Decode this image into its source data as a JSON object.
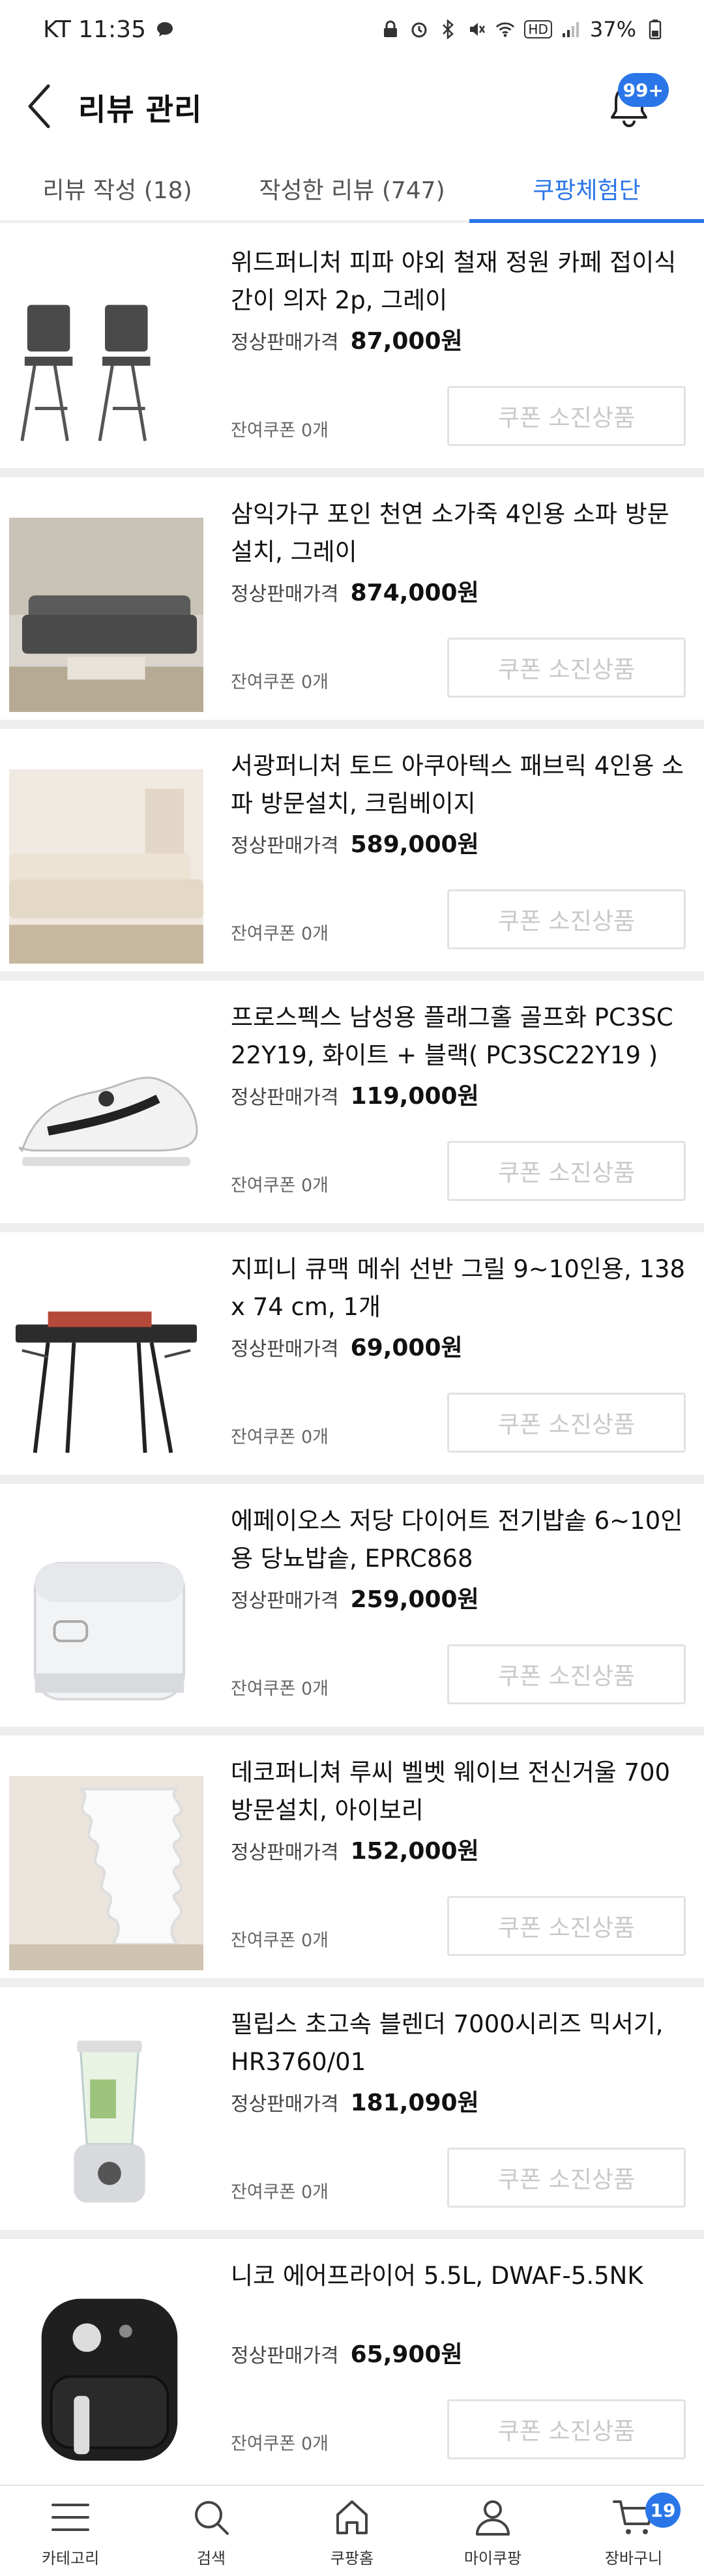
{
  "status_bar": {
    "carrier_time": "KT 11:35",
    "battery": "37%",
    "hd_label": "HD"
  },
  "header": {
    "title": "리뷰 관리",
    "notification_badge": "99+"
  },
  "tabs": [
    {
      "label": "리뷰 작성 (18)",
      "active": false
    },
    {
      "label": "작성한 리뷰 (747)",
      "active": false
    },
    {
      "label": "쿠팡체험단",
      "active": true
    }
  ],
  "common": {
    "price_label": "정상판매가격",
    "coupon_button": "쿠폰 소진상품"
  },
  "products": [
    {
      "name": "위드퍼니처 피파 야외 철재 정원 카페 접이식 간이 의자 2p, 그레이",
      "price": "87,000원",
      "coupon": "잔여쿠폰 0개",
      "thumb": "chairs"
    },
    {
      "name": "삼익가구 포인 천연 소가죽 4인용 소파 방문설치, 그레이",
      "price": "874,000원",
      "coupon": "잔여쿠폰 0개",
      "thumb": "sofa-gray"
    },
    {
      "name": "서광퍼니처 토드 아쿠아텍스 패브릭 4인용 소파 방문설치, 크림베이지",
      "price": "589,000원",
      "coupon": "잔여쿠폰 0개",
      "thumb": "sofa-cream"
    },
    {
      "name": "프로스펙스 남성용 플래그홀 골프화 PC3SC22Y19, 화이트 + 블랙( PC3SC22Y19 )",
      "price": "119,000원",
      "coupon": "잔여쿠폰 0개",
      "thumb": "golf-shoe"
    },
    {
      "name": "지피니 큐맥 메쉬 선반 그릴 9~10인용, 138 x 74 cm, 1개",
      "price": "69,000원",
      "coupon": "잔여쿠폰 0개",
      "thumb": "grill"
    },
    {
      "name": "에페이오스 저당 다이어트 전기밥솥 6~10인용 당뇨밥솥, EPRC868",
      "price": "259,000원",
      "coupon": "잔여쿠폰 0개",
      "thumb": "rice-cooker"
    },
    {
      "name": "데코퍼니쳐 루씨 벨벳 웨이브 전신거울 700 방문설치, 아이보리",
      "price": "152,000원",
      "coupon": "잔여쿠폰 0개",
      "thumb": "mirror"
    },
    {
      "name": "필립스 초고속 블렌더 7000시리즈 믹서기, HR3760/01",
      "price": "181,090원",
      "coupon": "잔여쿠폰 0개",
      "thumb": "blender"
    },
    {
      "name": "니코 에어프라이어 5.5L, DWAF-5.5NK",
      "price": "65,900원",
      "coupon": "잔여쿠폰 0개",
      "thumb": "air-fryer"
    }
  ],
  "bottom_nav": [
    {
      "label": "카테고리",
      "icon": "menu-icon"
    },
    {
      "label": "검색",
      "icon": "search-icon"
    },
    {
      "label": "쿠팡홈",
      "icon": "home-icon"
    },
    {
      "label": "마이쿠팡",
      "icon": "user-icon"
    },
    {
      "label": "장바구니",
      "icon": "cart-icon",
      "badge": "19"
    }
  ],
  "colors": {
    "accent": "#2a76e8",
    "separator": "#eeeeee",
    "disabled_text": "#c9c9c9"
  }
}
